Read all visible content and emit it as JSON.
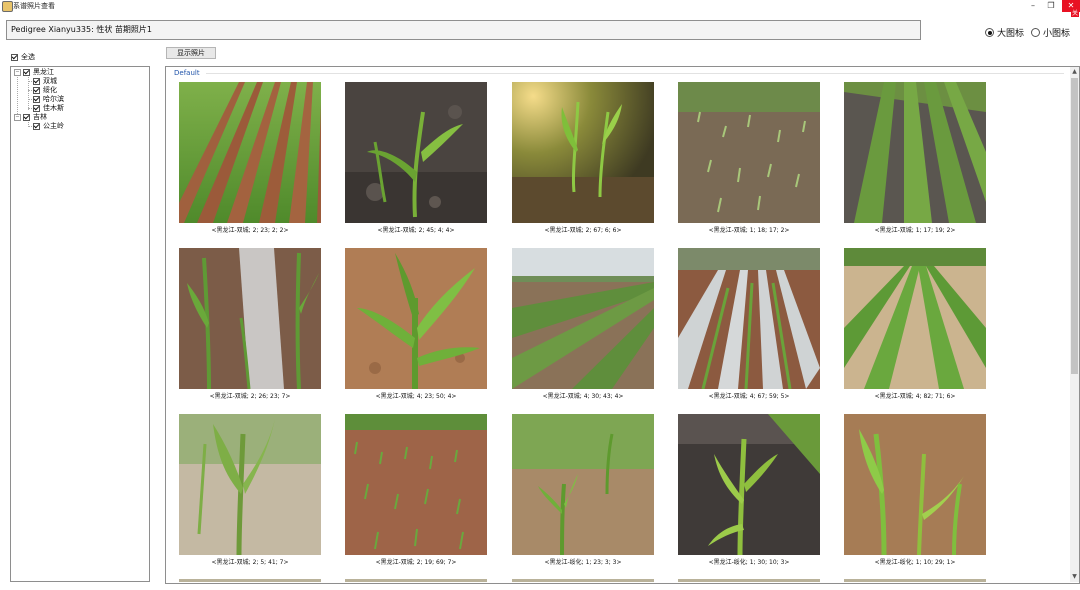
{
  "window": {
    "title": "系谱照片查看",
    "minimize_icon": "minimize-icon",
    "restore_icon": "restore-icon",
    "close_icon": "close-icon",
    "close_tab_label": "关"
  },
  "header": {
    "text": "Pedigree Xianyu335: 性状 苗期照片1"
  },
  "view_mode": {
    "large_label": "大图标",
    "small_label": "小图标",
    "selected": "large"
  },
  "select_all": {
    "label": "全选",
    "checked": true
  },
  "show_button": {
    "label": "显示照片"
  },
  "tree": [
    {
      "label": "黑龙江",
      "level": 0,
      "checked": true,
      "expanded": true
    },
    {
      "label": "双城",
      "level": 1,
      "checked": true
    },
    {
      "label": "绥化",
      "level": 1,
      "checked": true
    },
    {
      "label": "哈尔滨",
      "level": 1,
      "checked": true
    },
    {
      "label": "佳木斯",
      "level": 1,
      "checked": true
    },
    {
      "label": "吉林",
      "level": 0,
      "checked": true,
      "expanded": true
    },
    {
      "label": "公主岭",
      "level": 1,
      "checked": true
    }
  ],
  "gallery": {
    "group_label": "Default",
    "photos": [
      {
        "caption": "<黑龙江-双城; 2; 23; 2; 2>",
        "scene": "rows-green"
      },
      {
        "caption": "<黑龙江-双城; 2; 45; 4; 4>",
        "scene": "seedling-dark"
      },
      {
        "caption": "<黑龙江-双城; 2; 67; 6; 6>",
        "scene": "seedling-sunlit"
      },
      {
        "caption": "<黑龙江-双城; 1; 18; 17; 2>",
        "scene": "sparse-soil"
      },
      {
        "caption": "<黑龙江-双城; 1; 17; 19; 2>",
        "scene": "furrows"
      },
      {
        "caption": "<黑龙江-双城; 2; 26; 23; 7>",
        "scene": "plastic-mulch"
      },
      {
        "caption": "<黑龙江-双城; 4; 23; 50; 4>",
        "scene": "closeup-leaves"
      },
      {
        "caption": "<黑龙江-双城; 4; 30; 43; 4>",
        "scene": "field-horizon"
      },
      {
        "caption": "<黑龙江-双城; 4; 67; 59; 5>",
        "scene": "film-rows"
      },
      {
        "caption": "<黑龙江-双城; 4; 82; 71; 6>",
        "scene": "rows-perspective"
      },
      {
        "caption": "<黑龙江-双城; 2; 5; 41; 7>",
        "scene": "pale-soil"
      },
      {
        "caption": "<黑龙江-双城; 2; 19; 69; 7>",
        "scene": "red-soil-rows"
      },
      {
        "caption": "<黑龙江-绥化; 1; 23; 3; 3>",
        "scene": "seedling-blur"
      },
      {
        "caption": "<黑龙江-绥化; 1; 30; 10; 3>",
        "scene": "dark-furrow"
      },
      {
        "caption": "<黑龙江-绥化; 1; 10; 29; 1>",
        "scene": "bright-leaves"
      }
    ]
  },
  "scrollbar": {
    "up_icon": "scroll-up-icon",
    "down_icon": "scroll-down-icon",
    "position_fraction": 0.0,
    "visible_fraction": 0.62
  }
}
